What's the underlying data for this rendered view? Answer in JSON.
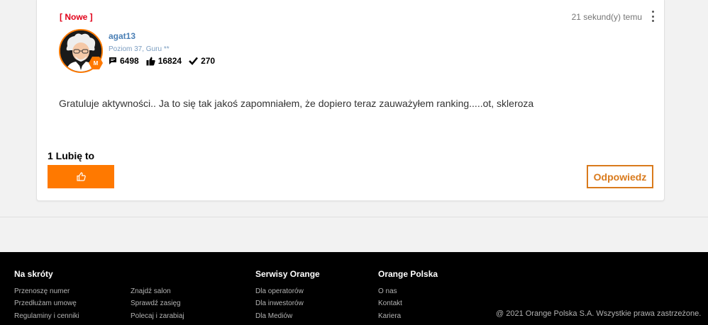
{
  "post": {
    "new_tag": "[ Nowe ]",
    "timestamp": "21 sekund(y) temu",
    "author": {
      "username": "agat13",
      "rank": "Poziom 37, Guru **",
      "badge_letter": "M",
      "stats": {
        "posts": "6498",
        "likes": "16824",
        "solutions": "270"
      }
    },
    "body": "Gratuluje aktywności.. Ja to się tak jakoś zapomniałem, że dopiero teraz zauważyłem ranking.....ot, skleroza",
    "likes_label": "1 Lubię to",
    "reply_label": "Odpowiedz"
  },
  "footer": {
    "columns": [
      {
        "heading": "Na skróty",
        "links": [
          "Przenoszę numer",
          "Przedłużam umowę",
          "Regulaminy i cenniki"
        ]
      },
      {
        "heading": "",
        "links": [
          "Znajdź salon",
          "Sprawdź zasięg",
          "Polecaj i zarabiaj"
        ]
      },
      {
        "heading": "Serwisy Orange",
        "links": [
          "Dla operatorów",
          "Dla inwestorów",
          "Dla Mediów"
        ]
      },
      {
        "heading": "Orange Polska",
        "links": [
          "O nas",
          "Kontakt",
          "Kariera"
        ]
      }
    ],
    "copyright": "@ 2021 Orange Polska S.A.  Wszystkie prawa zastrzeżone."
  },
  "colors": {
    "brand_orange": "#ff7900",
    "new_tag_red": "#e10019",
    "username_blue": "#4a7fb5"
  },
  "icons": {
    "posts": "speech-bubble-icon",
    "likes": "thumbs-up-icon",
    "solutions": "checkmark-icon",
    "like_button": "thumbs-up-outline-icon",
    "menu": "kebab-menu-icon"
  }
}
